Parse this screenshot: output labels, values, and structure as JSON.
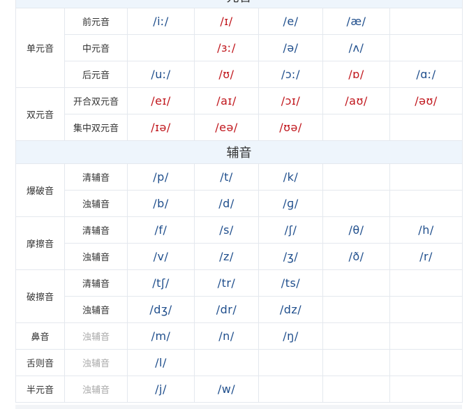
{
  "sections": [
    {
      "title": "元音",
      "groups": [
        {
          "category": "单元音",
          "rows": [
            {
              "sub": "前元音",
              "sub_gray": false,
              "cells": [
                {
                  "text": "/iː/",
                  "color": "#1f4e8c"
                },
                {
                  "text": "/ɪ/",
                  "color": "#c0161c"
                },
                {
                  "text": "/e/",
                  "color": "#1f4e8c"
                },
                {
                  "text": "/æ/",
                  "color": "#1f4e8c"
                },
                {
                  "text": "",
                  "color": "#1f4e8c"
                }
              ]
            },
            {
              "sub": "中元音",
              "sub_gray": false,
              "cells": [
                {
                  "text": "",
                  "color": "#1f4e8c"
                },
                {
                  "text": "/ɜː/",
                  "color": "#c0161c"
                },
                {
                  "text": "/ə/",
                  "color": "#1f4e8c"
                },
                {
                  "text": "/ʌ/",
                  "color": "#1f4e8c"
                },
                {
                  "text": "",
                  "color": "#1f4e8c"
                }
              ]
            },
            {
              "sub": "后元音",
              "sub_gray": false,
              "cells": [
                {
                  "text": "/uː/",
                  "color": "#1f4e8c"
                },
                {
                  "text": "/ʊ/",
                  "color": "#c0161c"
                },
                {
                  "text": "/ɔː/",
                  "color": "#1f4e8c"
                },
                {
                  "text": "/ɒ/",
                  "color": "#c0161c"
                },
                {
                  "text": "/ɑː/",
                  "color": "#1f4e8c"
                }
              ]
            }
          ]
        },
        {
          "category": "双元音",
          "rows": [
            {
              "sub": "开合双元音",
              "sub_gray": false,
              "cells": [
                {
                  "text": "/eɪ/",
                  "color": "#c0161c"
                },
                {
                  "text": "/aɪ/",
                  "color": "#c0161c"
                },
                {
                  "text": "/ɔɪ/",
                  "color": "#c0161c"
                },
                {
                  "text": "/aʊ/",
                  "color": "#c0161c"
                },
                {
                  "text": "/əʊ/",
                  "color": "#c0161c"
                }
              ]
            },
            {
              "sub": "集中双元音",
              "sub_gray": false,
              "cells": [
                {
                  "text": "/ɪə/",
                  "color": "#c0161c"
                },
                {
                  "text": "/eə/",
                  "color": "#c0161c"
                },
                {
                  "text": "/ʊə/",
                  "color": "#c0161c"
                },
                {
                  "text": "",
                  "color": "#1f4e8c"
                },
                {
                  "text": "",
                  "color": "#1f4e8c"
                }
              ]
            }
          ]
        }
      ]
    },
    {
      "title": "辅音",
      "groups": [
        {
          "category": "爆破音",
          "rows": [
            {
              "sub": "清辅音",
              "sub_gray": false,
              "cells": [
                {
                  "text": "/p/",
                  "color": "#1f4e8c"
                },
                {
                  "text": "/t/",
                  "color": "#1f4e8c"
                },
                {
                  "text": "/k/",
                  "color": "#1f4e8c"
                },
                {
                  "text": "",
                  "color": "#1f4e8c"
                },
                {
                  "text": "",
                  "color": "#1f4e8c"
                }
              ]
            },
            {
              "sub": "浊辅音",
              "sub_gray": false,
              "cells": [
                {
                  "text": "/b/",
                  "color": "#1f4e8c"
                },
                {
                  "text": "/d/",
                  "color": "#1f4e8c"
                },
                {
                  "text": "/ɡ/",
                  "color": "#1f4e8c"
                },
                {
                  "text": "",
                  "color": "#1f4e8c"
                },
                {
                  "text": "",
                  "color": "#1f4e8c"
                }
              ]
            }
          ]
        },
        {
          "category": "摩擦音",
          "rows": [
            {
              "sub": "清辅音",
              "sub_gray": false,
              "cells": [
                {
                  "text": "/f/",
                  "color": "#1f4e8c"
                },
                {
                  "text": "/s/",
                  "color": "#1f4e8c"
                },
                {
                  "text": "/ʃ/",
                  "color": "#1f4e8c"
                },
                {
                  "text": "/θ/",
                  "color": "#1f4e8c"
                },
                {
                  "text": "/h/",
                  "color": "#1f4e8c"
                }
              ]
            },
            {
              "sub": "浊辅音",
              "sub_gray": false,
              "cells": [
                {
                  "text": "/v/",
                  "color": "#1f4e8c"
                },
                {
                  "text": "/z/",
                  "color": "#1f4e8c"
                },
                {
                  "text": "/ʒ/",
                  "color": "#1f4e8c"
                },
                {
                  "text": "/ð/",
                  "color": "#1f4e8c"
                },
                {
                  "text": "/r/",
                  "color": "#1f4e8c"
                }
              ]
            }
          ]
        },
        {
          "category": "破擦音",
          "rows": [
            {
              "sub": "清辅音",
              "sub_gray": false,
              "cells": [
                {
                  "text": "/tʃ/",
                  "color": "#1f4e8c"
                },
                {
                  "text": "/tr/",
                  "color": "#1f4e8c"
                },
                {
                  "text": "/ts/",
                  "color": "#1f4e8c"
                },
                {
                  "text": "",
                  "color": "#1f4e8c"
                },
                {
                  "text": "",
                  "color": "#1f4e8c"
                }
              ]
            },
            {
              "sub": "浊辅音",
              "sub_gray": false,
              "cells": [
                {
                  "text": "/dʒ/",
                  "color": "#1f4e8c"
                },
                {
                  "text": "/dr/",
                  "color": "#1f4e8c"
                },
                {
                  "text": "/dz/",
                  "color": "#1f4e8c"
                },
                {
                  "text": "",
                  "color": "#1f4e8c"
                },
                {
                  "text": "",
                  "color": "#1f4e8c"
                }
              ]
            }
          ]
        },
        {
          "category": "鼻音",
          "rows": [
            {
              "sub": "浊辅音",
              "sub_gray": true,
              "cells": [
                {
                  "text": "/m/",
                  "color": "#1f4e8c"
                },
                {
                  "text": "/n/",
                  "color": "#1f4e8c"
                },
                {
                  "text": "/ŋ/",
                  "color": "#1f4e8c"
                },
                {
                  "text": "",
                  "color": "#1f4e8c"
                },
                {
                  "text": "",
                  "color": "#1f4e8c"
                }
              ]
            }
          ]
        },
        {
          "category": "舌则音",
          "rows": [
            {
              "sub": "浊辅音",
              "sub_gray": true,
              "cells": [
                {
                  "text": "/l/",
                  "color": "#1f4e8c"
                },
                {
                  "text": "",
                  "color": "#1f4e8c"
                },
                {
                  "text": "",
                  "color": "#1f4e8c"
                },
                {
                  "text": "",
                  "color": "#1f4e8c"
                },
                {
                  "text": "",
                  "color": "#1f4e8c"
                }
              ]
            }
          ]
        },
        {
          "category": "半元音",
          "rows": [
            {
              "sub": "浊辅音",
              "sub_gray": true,
              "cells": [
                {
                  "text": "/j/",
                  "color": "#1f4e8c"
                },
                {
                  "text": "/w/",
                  "color": "#1f4e8c"
                },
                {
                  "text": "",
                  "color": "#1f4e8c"
                },
                {
                  "text": "",
                  "color": "#1f4e8c"
                },
                {
                  "text": "",
                  "color": "#1f4e8c"
                }
              ]
            }
          ]
        }
      ]
    }
  ]
}
